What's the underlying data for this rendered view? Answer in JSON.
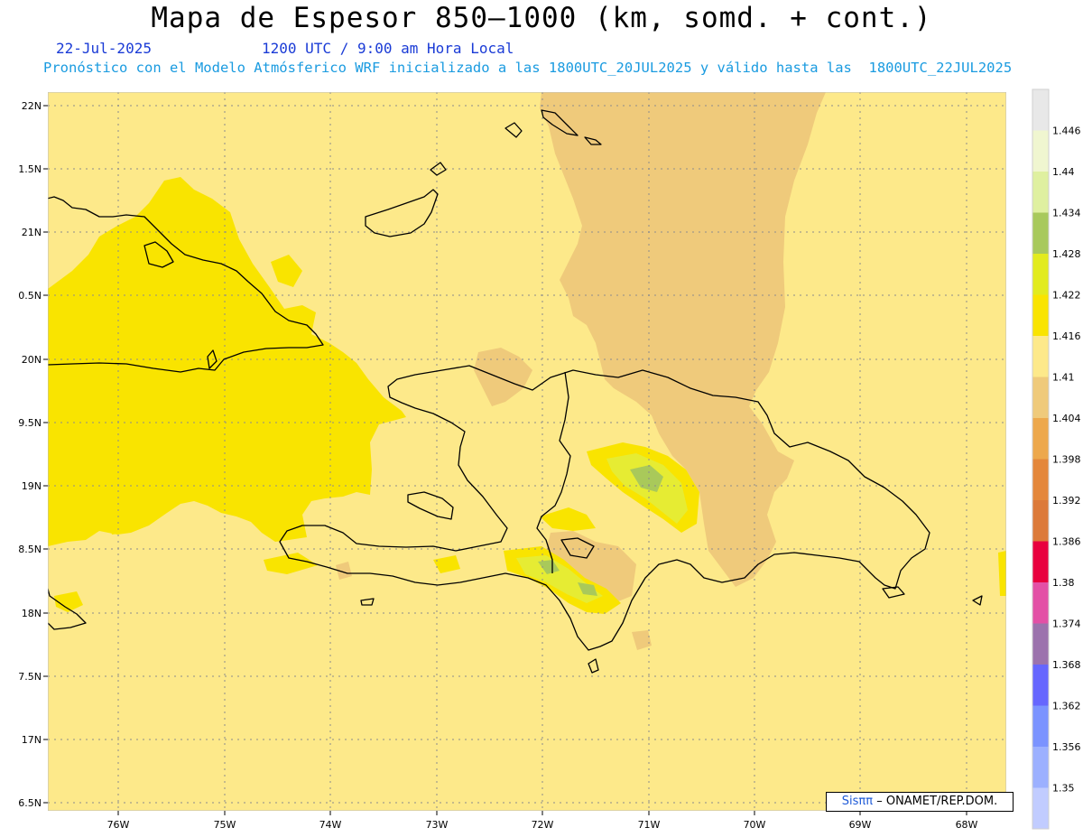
{
  "header": {
    "title": "Mapa de Espesor 850—1000 (km, somd. + cont.)",
    "date": "22-Jul-2025",
    "time": "1200 UTC / 9:00 am Hora Local",
    "description": "Pronóstico con el Modelo Atmósferico WRF inicializado a las 1800UTC_20JUL2025 y válido hasta las  1800UTC_22JUL2025"
  },
  "map": {
    "region": "Hispaniola",
    "lon_range": [
      -76.65,
      -67.6
    ],
    "lat_range": [
      16.35,
      22.1
    ],
    "lon_ticks": [
      "76W",
      "75W",
      "74W",
      "73W",
      "72W",
      "71W",
      "70W",
      "69W",
      "68W"
    ],
    "lat_ticks": [
      "22N",
      "1.5N",
      "21N",
      "0.5N",
      "20N",
      "9.5N",
      "19N",
      "8.5N",
      "18N",
      "7.5N",
      "17N",
      "6.5N"
    ],
    "colors": {
      "background": "#fde98a",
      "level_1_416": "#f9e400",
      "level_1_404": "#efca7b",
      "level_1_422": "#e6ec33",
      "level_1_428": "#a9c95a",
      "grid": "#888888",
      "coastline": "#000000"
    }
  },
  "colorbar": {
    "levels": [
      "1.446",
      "1.44",
      "1.434",
      "1.428",
      "1.422",
      "1.416",
      "1.41",
      "1.404",
      "1.398",
      "1.392",
      "1.386",
      "1.38",
      "1.374",
      "1.368",
      "1.362",
      "1.356",
      "1.35"
    ],
    "colors": [
      "#e8e8e8",
      "#f0f6d0",
      "#dff0a0",
      "#a8c95c",
      "#e2eb1e",
      "#f9e400",
      "#fde98a",
      "#efca7b",
      "#eda84c",
      "#e4873b",
      "#dc7a3a",
      "#e8003e",
      "#e350a6",
      "#9c72ad",
      "#6666fe",
      "#7b93ff",
      "#9cb0ff",
      "#c1ccff"
    ]
  },
  "credit": {
    "sis": "Sisππ",
    "rest": "– ONAMET/REP.DOM."
  }
}
